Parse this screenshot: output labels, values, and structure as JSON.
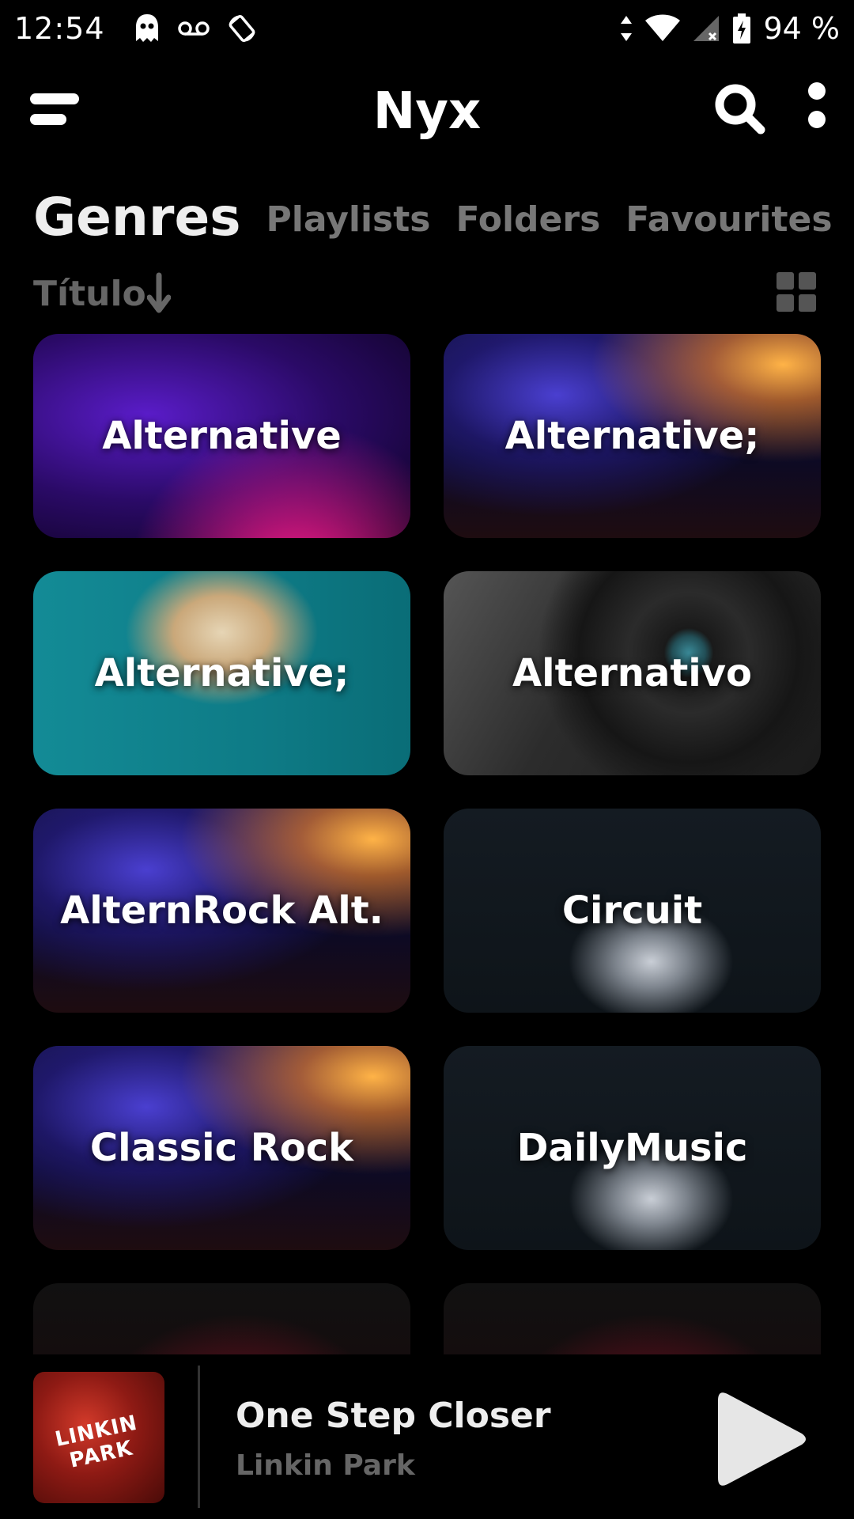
{
  "status_bar": {
    "time": "12:54",
    "battery_percent": "94 %",
    "left_icons": [
      "ghost-icon",
      "voicemail-icon",
      "rotate-icon"
    ],
    "right_icons": [
      "data-arrows-icon",
      "wifi-icon",
      "signal-icon",
      "battery-charging-icon"
    ]
  },
  "app_bar": {
    "title": "Nyx",
    "menu_icon": "menu-icon",
    "search_icon": "search-icon",
    "more_icon": "more-vert-icon"
  },
  "tabs": [
    {
      "label": "Genres",
      "active": true
    },
    {
      "label": "Playlists",
      "active": false
    },
    {
      "label": "Folders",
      "active": false
    },
    {
      "label": "Favourites",
      "active": false
    }
  ],
  "sort": {
    "label": "Título",
    "direction_icon": "arrow-down-icon",
    "view_toggle_icon": "grid-view-icon"
  },
  "genres": [
    {
      "label": "Alternative",
      "art": "dj-turntable"
    },
    {
      "label": "Alternative;",
      "art": "concert-stage"
    },
    {
      "label": "Alternative;",
      "art": "girl-sunglasses"
    },
    {
      "label": "Alternativo",
      "art": "vinyl-record"
    },
    {
      "label": "AlternRock Alt.",
      "art": "concert-stage"
    },
    {
      "label": "Circuit",
      "art": "electric-guitar"
    },
    {
      "label": "Classic Rock",
      "art": "concert-stage"
    },
    {
      "label": "DailyMusic",
      "art": "electric-guitar"
    },
    {
      "label": "",
      "art": "red-stage"
    },
    {
      "label": "",
      "art": "red-stage"
    }
  ],
  "player": {
    "track_title": "One Step Closer",
    "artist": "Linkin Park",
    "album_art_text": "LINKIN PARK",
    "play_icon": "play-icon"
  },
  "colors": {
    "background": "#000000",
    "active_tab": "#eeeeee",
    "inactive_tab": "#777777",
    "secondary_text": "#666666"
  }
}
